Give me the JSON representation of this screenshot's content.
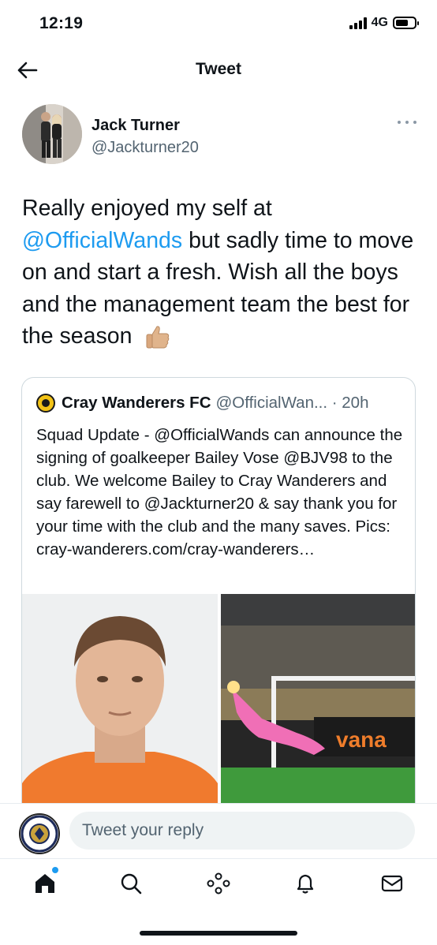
{
  "status_bar": {
    "time": "12:19",
    "network": "4G"
  },
  "header": {
    "title": "Tweet"
  },
  "author": {
    "name": "Jack Turner",
    "handle": "@Jackturner20"
  },
  "tweet": {
    "text_part1": "Really enjoyed my self at ",
    "mention": "@OfficialWands",
    "text_part2": " but sadly time to move on and start a fresh. Wish all the boys and the management team the best for the season",
    "emoji": "thumbs-up-emoji"
  },
  "quoted_tweet": {
    "name": "Cray Wanderers FC",
    "handle_time": "@OfficialWan... · 20h",
    "text": "Squad Update - @OfficialWands can announce the signing of goalkeeper Bailey Vose @BJV98 to the club. We welcome Bailey to Cray Wanderers and say farewell to @Jackturner20 & say thank you for your time with the club and the many saves. Pics: cray-wanderers.com/cray-wanderers…",
    "image_right_sign": "vana"
  },
  "reply": {
    "placeholder": "Tweet your reply"
  },
  "colors": {
    "accent": "#1d9bf0",
    "secondary_text": "#536471",
    "border": "#cfd9de"
  },
  "nav_icons": [
    "home-icon",
    "search-icon",
    "spaces-icon",
    "notifications-icon",
    "messages-icon"
  ]
}
